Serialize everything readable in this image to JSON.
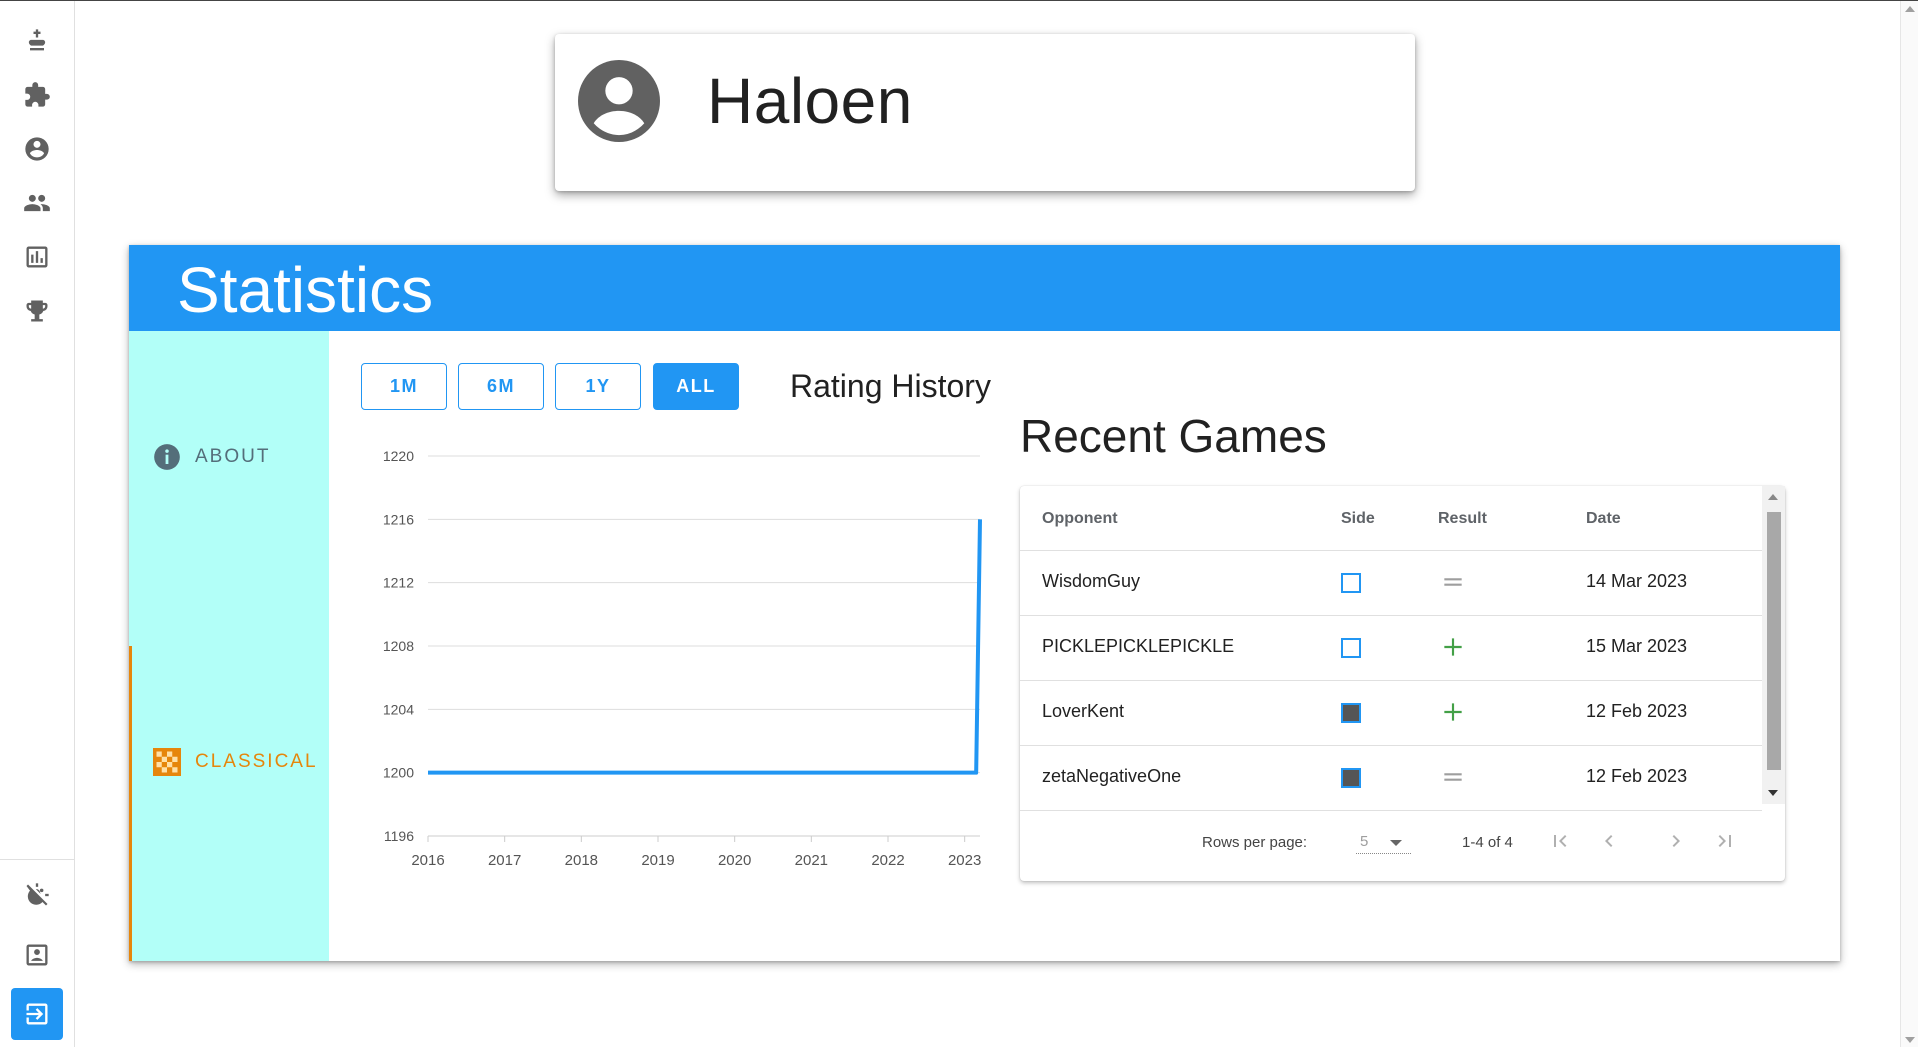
{
  "nav": {
    "icons": [
      "chess-king-icon",
      "puzzle-icon",
      "account-circle-icon",
      "people-icon",
      "bar-chart-icon",
      "trophy-icon",
      "theme-toggle-icon",
      "contact-icon",
      "logout-icon"
    ]
  },
  "profile": {
    "username": "Haloen"
  },
  "stats": {
    "title": "Statistics",
    "tabs": {
      "about": "ABOUT",
      "classical": "CLASSICAL"
    },
    "range_buttons": {
      "one_month": "1M",
      "six_months": "6M",
      "one_year": "1Y",
      "all": "ALL"
    },
    "active_range": "ALL",
    "rating_title": "Rating History"
  },
  "chart_data": {
    "type": "line",
    "title": "Rating History",
    "x_ticks": [
      "2016",
      "2017",
      "2018",
      "2019",
      "2020",
      "2021",
      "2022",
      "2023"
    ],
    "y_ticks": [
      1196,
      1200,
      1204,
      1208,
      1212,
      1216,
      1220
    ],
    "ylim": [
      1196,
      1220
    ],
    "xlim": [
      2016,
      2023.2
    ],
    "grid": true,
    "series": [
      {
        "x": [
          2016,
          2023.15,
          2023.2
        ],
        "values": [
          1200,
          1200,
          1216
        ]
      }
    ],
    "line_color": "#2196f3"
  },
  "recent_games": {
    "title": "Recent Games",
    "columns": {
      "opponent": "Opponent",
      "side": "Side",
      "result": "Result",
      "date": "Date"
    },
    "rows": [
      {
        "opponent": "WisdomGuy",
        "side": "white",
        "result": "draw",
        "date": "14 Mar 2023"
      },
      {
        "opponent": "PICKLEPICKLEPICKLE",
        "side": "white",
        "result": "win",
        "date": "15 Mar 2023"
      },
      {
        "opponent": "LoverKent",
        "side": "black",
        "result": "win",
        "date": "12 Feb 2023"
      },
      {
        "opponent": "zetaNegativeOne",
        "side": "black",
        "result": "draw",
        "date": "12 Feb 2023"
      }
    ],
    "pager": {
      "rows_per_page_label": "Rows per page:",
      "rows_per_page": "5",
      "range_text": "1-4 of 4"
    }
  },
  "colors": {
    "accent": "#2196f3",
    "classical": "#e6860b",
    "sidebar_bg": "#b2fff8",
    "win": "#43a047",
    "draw": "#9e9e9e"
  }
}
